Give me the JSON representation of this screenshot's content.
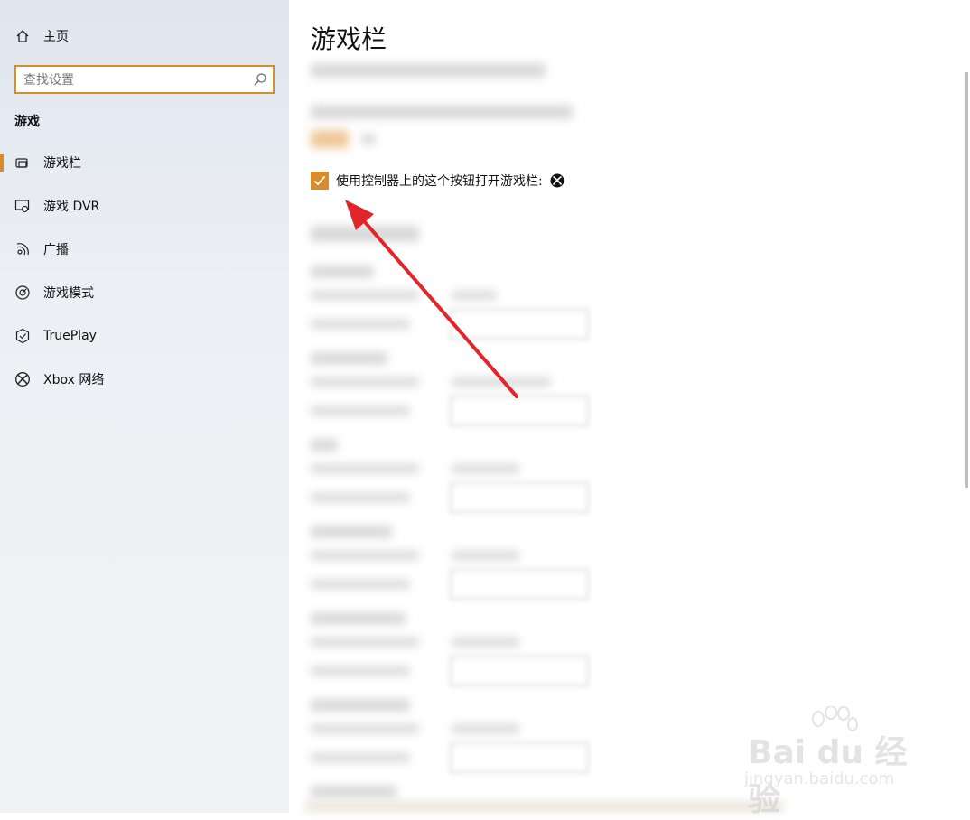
{
  "sidebar": {
    "home_label": "主页",
    "search_placeholder": "查找设置",
    "section_title": "游戏",
    "items": [
      {
        "label": "游戏栏",
        "icon": "game-bar-icon",
        "active": true
      },
      {
        "label": "游戏 DVR",
        "icon": "game-dvr-icon",
        "active": false
      },
      {
        "label": "广播",
        "icon": "broadcast-icon",
        "active": false
      },
      {
        "label": "游戏模式",
        "icon": "game-mode-icon",
        "active": false
      },
      {
        "label": "TruePlay",
        "icon": "trueplay-icon",
        "active": false
      },
      {
        "label": "Xbox 网络",
        "icon": "xbox-network-icon",
        "active": false
      }
    ]
  },
  "main": {
    "page_title": "游戏栏",
    "controller_checkbox": {
      "label": "使用控制器上的这个按钮打开游戏栏:",
      "checked": true,
      "icon": "xbox-logo-icon"
    }
  },
  "watermark": {
    "brand": "Bai du 经验",
    "domain": "jingyan.baidu.com"
  },
  "colors": {
    "accent": "#d88c2b",
    "annotation_arrow": "#e0262b"
  }
}
